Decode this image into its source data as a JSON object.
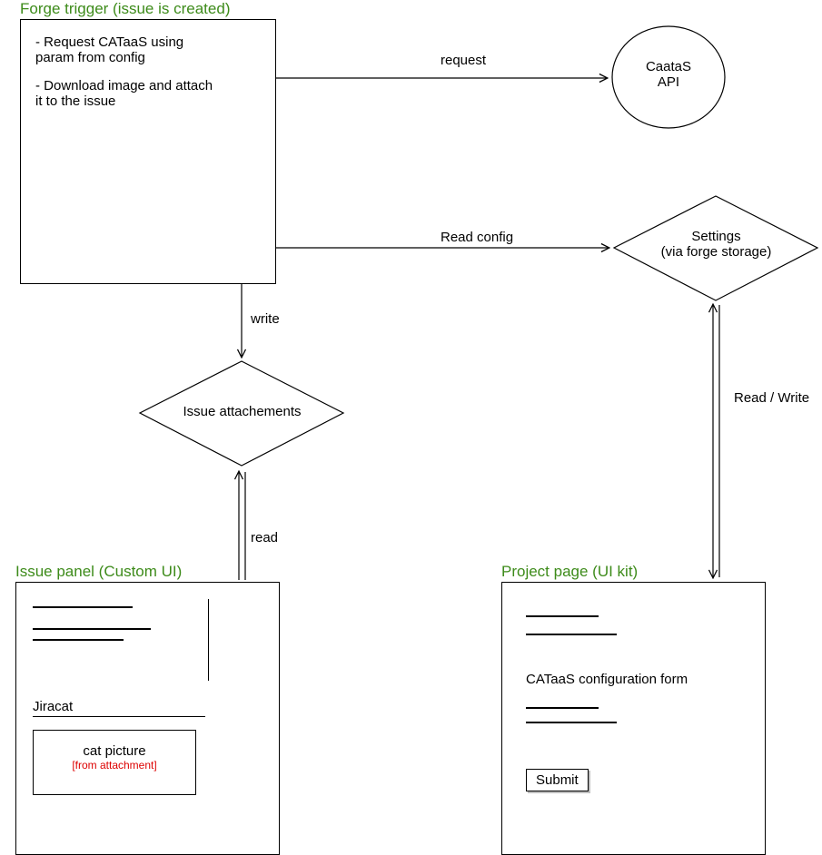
{
  "forge_trigger": {
    "title": "Forge trigger (issue is created)",
    "line1a": "- Request CATaaS using",
    "line1b": "param from config",
    "line2a": "- Download image and attach",
    "line2b": "it to the issue"
  },
  "cataas_api": "CaataS\nAPI",
  "settings": {
    "line1": "Settings",
    "line2": "(via forge storage)"
  },
  "diamond_issue": "Issue attachements",
  "issue_panel": {
    "title": "Issue panel (Custom UI)",
    "section_label": "Jiracat",
    "pic_label": "cat picture",
    "pic_sub": "[from attachment]"
  },
  "project_page": {
    "title": "Project page (UI kit)",
    "form_label": "CATaaS configuration form",
    "submit": "Submit"
  },
  "edges": {
    "request": "request",
    "read_config": "Read config",
    "write": "write",
    "read": "read",
    "read_write": "Read / Write"
  }
}
